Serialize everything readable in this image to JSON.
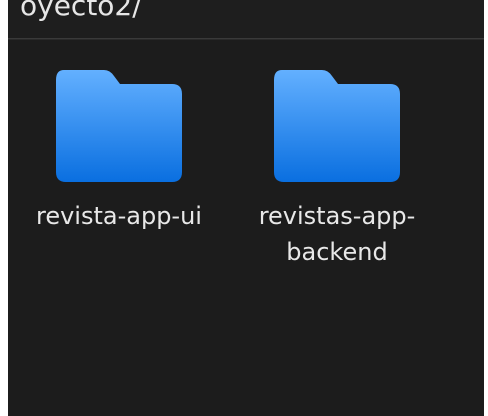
{
  "location": {
    "path_text": "oyecto2/"
  },
  "files": [
    {
      "name_line1": "revista-app-ui",
      "name_line2": "",
      "icon": "folder-icon"
    },
    {
      "name_line1": "revistas-app-",
      "name_line2": "backend",
      "icon": "folder-icon"
    }
  ],
  "colors": {
    "background": "#1c1c1c",
    "folder_top": "#5aa9ff",
    "folder_bottom": "#0a6fe0",
    "text": "#e8e8e8"
  }
}
